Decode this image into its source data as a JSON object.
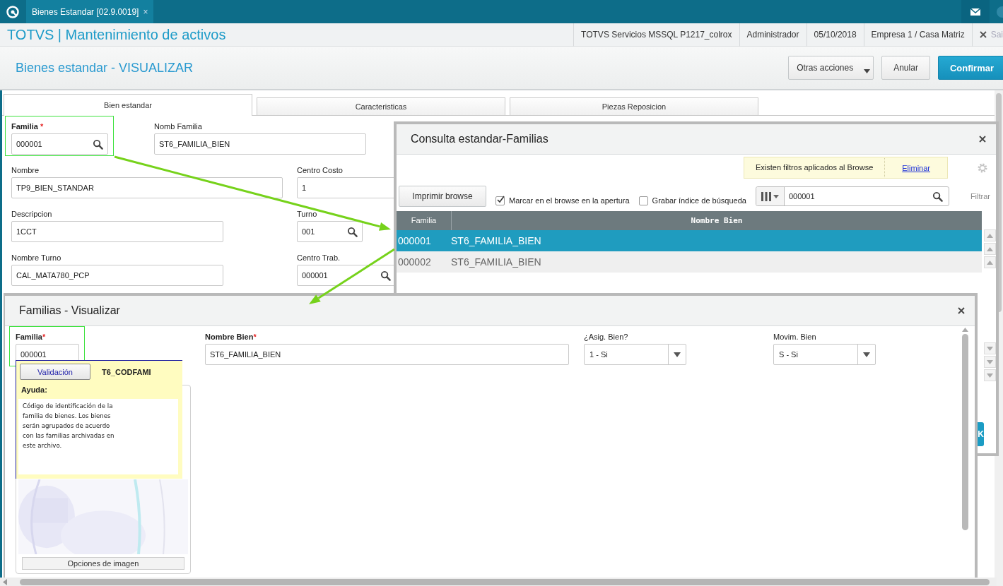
{
  "top_bar": {
    "tab": {
      "label": "Bienes Estandar [02.9.0019]",
      "close": "×"
    }
  },
  "header": {
    "title": "TOTVS | Mantenimiento de activos",
    "info": [
      "TOTVS Servicios MSSQL P1217_colrox",
      "Administrador",
      "05/10/2018",
      "Empresa 1 / Casa Matriz"
    ],
    "exit": "Sai"
  },
  "page": {
    "title": "Bienes estandar - VISUALIZAR",
    "buttons": [
      {
        "label": "Otras acciones",
        "kind": "menu"
      },
      {
        "label": "Anular",
        "kind": "plain"
      },
      {
        "label": "Confirmar",
        "kind": "primary"
      }
    ]
  },
  "tabs": [
    {
      "label": "Bien estandar",
      "selected": true
    },
    {
      "label": "Caracteristicas",
      "selected": false
    },
    {
      "label": "Piezas Reposicion",
      "selected": false
    }
  ],
  "form": {
    "rows": [
      [
        {
          "label": "Familia",
          "mark": "*",
          "value": "000001",
          "lookup": true,
          "highlighted": true
        },
        {
          "label": "Nomb Familia",
          "value": "ST6_FAMILIA_BIEN",
          "lookup": false,
          "highlighted": false
        }
      ],
      [
        {
          "label": "Nombre",
          "value": "TP9_BIEN_STANDAR",
          "lookup": false,
          "highlighted": false
        },
        {
          "label": "Centro Costo",
          "value": "1",
          "lookup": false,
          "highlighted": false
        }
      ],
      [
        {
          "label": "Descripcion",
          "value": "1CCT",
          "lookup": false,
          "highlighted": false
        },
        {
          "label": "Turno",
          "value": "001",
          "lookup": true,
          "highlighted": false
        }
      ],
      [
        {
          "label": "Nombre Turno",
          "value": "CAL_MATA780_PCP",
          "lookup": false,
          "highlighted": false
        },
        {
          "label": "Centro Trab.",
          "value": "000001",
          "lookup": true,
          "highlighted": false
        }
      ]
    ]
  },
  "lookup_dialog": {
    "title": "Consulta estandar-Familias",
    "notice": "Existen filtros aplicados al Browse",
    "notice_link": "Eliminar",
    "print_button": "Imprimir browse",
    "checkboxes": [
      {
        "label": "Marcar en el browse en la apertura",
        "checked": true
      },
      {
        "label": "Grabar índice de búsqueda",
        "checked": false
      }
    ],
    "search": {
      "value": "000001"
    },
    "filter_label": "Filtrar",
    "table": {
      "columns": [
        "Familia",
        "Nombre Bien"
      ],
      "rows": [
        {
          "cells": [
            "000001",
            "ST6_FAMILIA_BIEN"
          ],
          "selected": true
        },
        {
          "cells": [
            "000002",
            "ST6_FAMILIA_BIEN"
          ],
          "selected": false
        }
      ]
    },
    "ok_button": "K"
  },
  "detail_dialog": {
    "title": "Familias - Visualizar",
    "fields": [
      {
        "label": "Familia",
        "mark": "*",
        "value": "000001",
        "kind": "text",
        "highlighted": true
      },
      {
        "label": "Nombre Bien",
        "mark": "*",
        "value": "ST6_FAMILIA_BIEN",
        "kind": "text",
        "highlighted": false
      },
      {
        "label": "¿Asig. Bien?",
        "value": "1 - Si",
        "kind": "select",
        "highlighted": false
      },
      {
        "label": "Movim. Bien",
        "value": "S - Si",
        "kind": "select",
        "highlighted": false
      }
    ],
    "help": {
      "button": "Validación",
      "field_code": "T6_CODFAMI",
      "heading": "Ayuda:",
      "text": "Código de identificación de la familia de bienes. Los bienes serán agrupados de acuerdo con las familias archivadas en este archivo."
    },
    "image_button": "Opciones de imagen"
  }
}
